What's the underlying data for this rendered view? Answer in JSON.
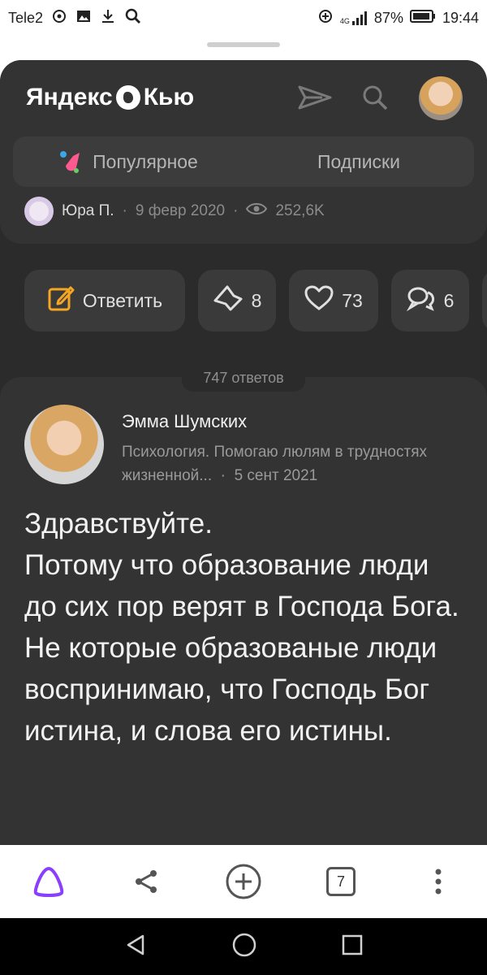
{
  "status": {
    "carrier": "Tele2",
    "battery": "87%",
    "time": "19:44",
    "network": "4G"
  },
  "header": {
    "logo_text_left": "Яндекс",
    "logo_text_right": "Кью",
    "icons": [
      "send-icon",
      "search-icon"
    ]
  },
  "tabs": [
    {
      "label": "Популярное"
    },
    {
      "label": "Подписки"
    }
  ],
  "question_meta": {
    "author": "Юра П.",
    "date": "9 февр 2020",
    "views": "252,6K"
  },
  "actions": {
    "reply_label": "Ответить",
    "upvotes": "8",
    "likes": "73",
    "comments": "6"
  },
  "answers_count": "747 ответов",
  "answer": {
    "author_name": "Эмма Шумских",
    "author_desc": "Психология. Помогаю люлям в трудностях жизненной...",
    "date": "5 сент 2021",
    "text_lines": [
      "Здравствуйте.",
      "Потому что образование люди до сих пор верят в Господа Бога.",
      "Не которые образованые люди воспринимаю, что Господь Бог истина, и слова его истины."
    ]
  },
  "bottom_bar": {
    "tab_count": "7",
    "icons": [
      "alice-icon",
      "share-icon",
      "add-icon",
      "tabs-icon",
      "more-icon"
    ]
  },
  "nav": {
    "icons": [
      "back-icon",
      "home-icon",
      "recents-icon"
    ]
  },
  "colors": {
    "background": "#2b2b2b",
    "card": "#333333",
    "alice_accent": "#8a3ffc",
    "reply_accent": "#f5a623"
  }
}
